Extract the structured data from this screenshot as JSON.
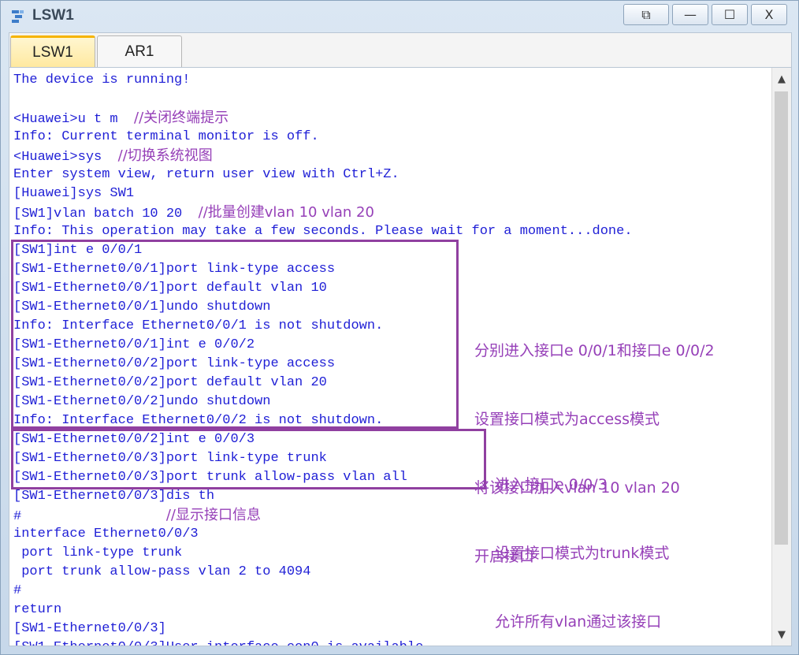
{
  "window": {
    "title": "LSW1",
    "controls": {
      "restore": "⧉",
      "minimize": "—",
      "maximize": "☐",
      "close": "X"
    }
  },
  "tabs": [
    {
      "label": "LSW1",
      "active": true
    },
    {
      "label": "AR1",
      "active": false
    }
  ],
  "terminal": {
    "lines": [
      {
        "text": "The device is running!",
        "note": ""
      },
      {
        "text": "",
        "note": ""
      },
      {
        "text": "<Huawei>u t m  ",
        "note": "//关闭终端提示"
      },
      {
        "text": "Info: Current terminal monitor is off.",
        "note": ""
      },
      {
        "text": "<Huawei>sys  ",
        "note": "//切换系统视图"
      },
      {
        "text": "Enter system view, return user view with Ctrl+Z.",
        "note": ""
      },
      {
        "text": "[Huawei]sys SW1",
        "note": ""
      },
      {
        "text": "[SW1]vlan batch 10 20  ",
        "note": "//批量创建vlan 10 vlan 20"
      },
      {
        "text": "Info: This operation may take a few seconds. Please wait for a moment...done.",
        "note": ""
      },
      {
        "text": "[SW1]int e 0/0/1",
        "note": ""
      },
      {
        "text": "[SW1-Ethernet0/0/1]port link-type access",
        "note": ""
      },
      {
        "text": "[SW1-Ethernet0/0/1]port default vlan 10",
        "note": ""
      },
      {
        "text": "[SW1-Ethernet0/0/1]undo shutdown",
        "note": ""
      },
      {
        "text": "Info: Interface Ethernet0/0/1 is not shutdown.",
        "note": ""
      },
      {
        "text": "[SW1-Ethernet0/0/1]int e 0/0/2",
        "note": ""
      },
      {
        "text": "[SW1-Ethernet0/0/2]port link-type access",
        "note": ""
      },
      {
        "text": "[SW1-Ethernet0/0/2]port default vlan 20",
        "note": ""
      },
      {
        "text": "[SW1-Ethernet0/0/2]undo shutdown",
        "note": ""
      },
      {
        "text": "Info: Interface Ethernet0/0/2 is not shutdown.",
        "note": ""
      },
      {
        "text": "[SW1-Ethernet0/0/2]int e 0/0/3",
        "note": ""
      },
      {
        "text": "[SW1-Ethernet0/0/3]port link-type trunk",
        "note": ""
      },
      {
        "text": "[SW1-Ethernet0/0/3]port trunk allow-pass vlan all",
        "note": ""
      },
      {
        "text": "[SW1-Ethernet0/0/3]dis th",
        "note": ""
      },
      {
        "text": "#                  ",
        "note": "//显示接口信息"
      },
      {
        "text": "interface Ethernet0/0/3",
        "note": ""
      },
      {
        "text": " port link-type trunk",
        "note": ""
      },
      {
        "text": " port trunk allow-pass vlan 2 to 4094",
        "note": ""
      },
      {
        "text": "#",
        "note": ""
      },
      {
        "text": "return",
        "note": ""
      },
      {
        "text": "[SW1-Ethernet0/0/3]",
        "note": ""
      },
      {
        "text": "[SW1-Ethernet0/0/3]User interface con0 is available",
        "note": ""
      }
    ]
  },
  "annotations": {
    "group1": [
      "分别进入接口e 0/0/1和接口e 0/0/2",
      "设置接口模式为access模式",
      "将该接口加入vlan 10 vlan 20",
      "开启接口"
    ],
    "group2": [
      "进入接口e 0/0/3",
      "设置接口模式为trunk模式",
      "允许所有vlan通过该接口"
    ]
  },
  "scrollbar": {
    "up": "▲",
    "down": "▼"
  },
  "colors": {
    "command_text": "#1f1fd6",
    "annotation": "#9640b8",
    "box_border": "#9040a0",
    "active_tab": "#ffe9a0"
  }
}
